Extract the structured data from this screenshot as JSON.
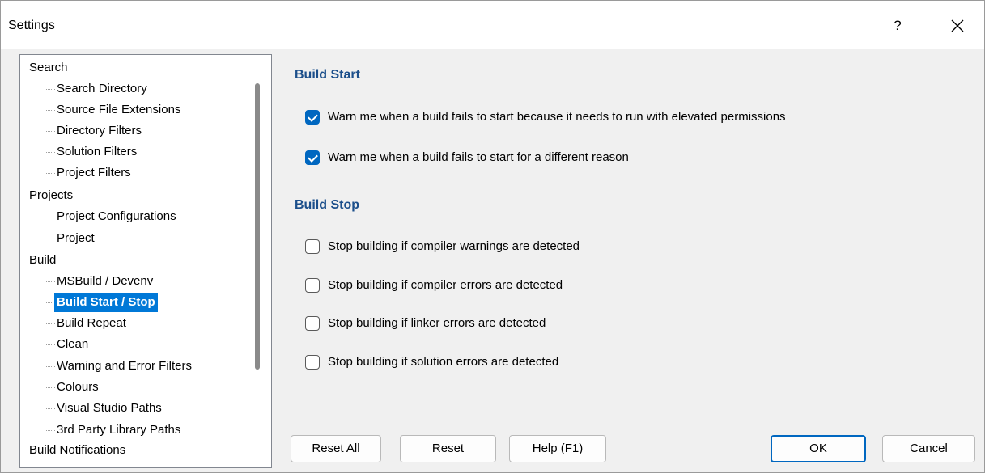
{
  "window": {
    "title": "Settings",
    "help_label": "?",
    "close_icon": "close-icon"
  },
  "tree": {
    "groups": [
      {
        "label": "Search",
        "children": [
          "Search Directory",
          "Source File Extensions",
          "Directory Filters",
          "Solution Filters",
          "Project Filters"
        ]
      },
      {
        "label": "Projects",
        "children": [
          "Project Configurations",
          "Project"
        ]
      },
      {
        "label": "Build",
        "children": [
          "MSBuild / Devenv",
          "Build Start / Stop",
          "Build Repeat",
          "Clean",
          "Warning and Error Filters",
          "Colours",
          "Visual Studio Paths",
          "3rd Party Library Paths"
        ]
      },
      {
        "label": "Build Notifications",
        "children": []
      }
    ],
    "selected": "Build Start / Stop"
  },
  "build_start": {
    "title": "Build Start",
    "options": [
      {
        "label": "Warn me when a build fails to start because it needs to run with elevated permissions",
        "checked": true
      },
      {
        "label": "Warn me when a build fails to start for a different reason",
        "checked": true
      }
    ]
  },
  "build_stop": {
    "title": "Build Stop",
    "options": [
      {
        "label": "Stop building if compiler warnings are detected",
        "checked": false
      },
      {
        "label": "Stop building if compiler errors are detected",
        "checked": false
      },
      {
        "label": "Stop building if linker errors are detected",
        "checked": false
      },
      {
        "label": "Stop building if solution errors are detected",
        "checked": false
      }
    ]
  },
  "buttons": {
    "reset_all": "Reset All",
    "reset": "Reset",
    "help": "Help (F1)",
    "ok": "OK",
    "cancel": "Cancel"
  },
  "colors": {
    "accent": "#0067c0",
    "selection": "#0078d7",
    "section_title": "#1c4f8b"
  }
}
